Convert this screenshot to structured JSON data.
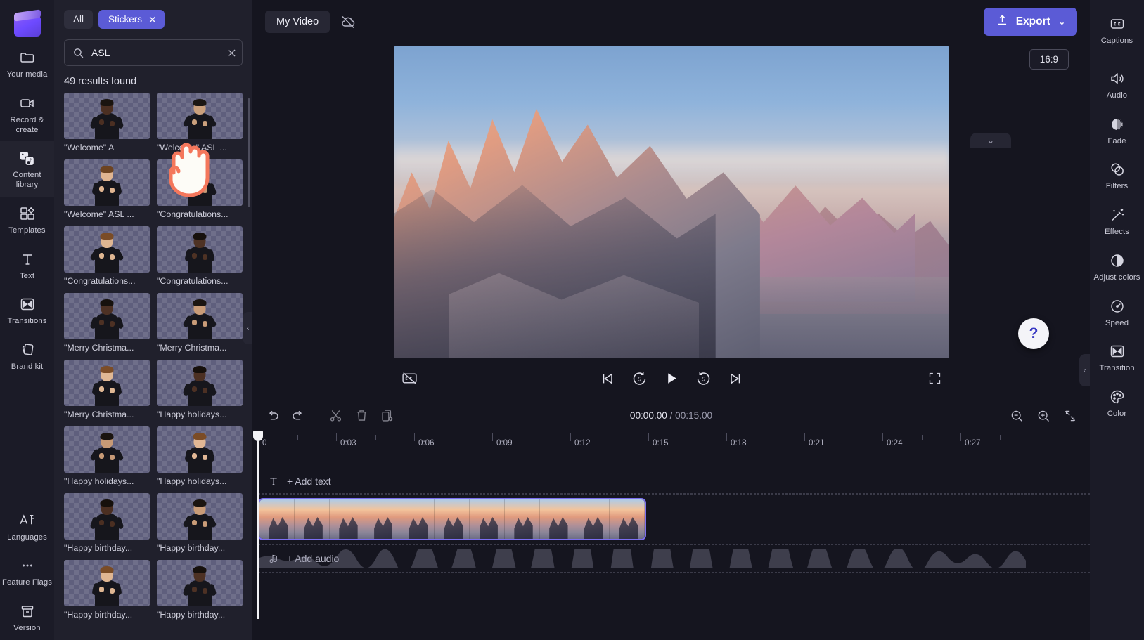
{
  "rail": {
    "logo": "clipchamp-logo",
    "items": [
      {
        "label": "Your media",
        "icon": "folder-icon",
        "active": false
      },
      {
        "label": "Record & create",
        "icon": "video-camera-icon",
        "active": false
      },
      {
        "label": "Content library",
        "icon": "content-library-icon",
        "active": true
      },
      {
        "label": "Templates",
        "icon": "templates-icon",
        "active": false
      },
      {
        "label": "Text",
        "icon": "text-icon",
        "active": false
      },
      {
        "label": "Transitions",
        "icon": "transitions-icon",
        "active": false
      },
      {
        "label": "Brand kit",
        "icon": "brand-kit-icon",
        "active": false
      }
    ],
    "bottom_items": [
      {
        "label": "Languages",
        "icon": "languages-icon"
      },
      {
        "label": "Feature Flags",
        "icon": "ellipsis-icon"
      },
      {
        "label": "Version",
        "icon": "archive-icon"
      }
    ]
  },
  "panel": {
    "chips": [
      {
        "label": "All",
        "selected": false
      },
      {
        "label": "Stickers",
        "selected": true,
        "close": "✕"
      }
    ],
    "search": {
      "value": "ASL",
      "placeholder": "Search",
      "clear": "✕"
    },
    "results_text": "49 results found",
    "collapse_arrow": "‹",
    "stickers": [
      {
        "label": "\"Welcome\" A",
        "skin": "#4b2f22",
        "hair": "#1a1410"
      },
      {
        "label": "\"Welcome\" ASL ...",
        "skin": "#caa07c",
        "hair": "#1c1713"
      },
      {
        "label": "\"Welcome\" ASL ...",
        "skin": "#e0b591",
        "hair": "#6d4422"
      },
      {
        "label": "\"Congratulations...",
        "skin": "#c59a76",
        "hair": "#191310"
      },
      {
        "label": "\"Congratulations...",
        "skin": "#dfb692",
        "hair": "#7a4c26"
      },
      {
        "label": "\"Congratulations...",
        "skin": "#4e3224",
        "hair": "#17110d"
      },
      {
        "label": "\"Merry Christma...",
        "skin": "#4d3124",
        "hair": "#17110d"
      },
      {
        "label": "\"Merry Christma...",
        "skin": "#c99c78",
        "hair": "#1b1511"
      },
      {
        "label": "\"Merry Christma...",
        "skin": "#e0b894",
        "hair": "#7c4d27"
      },
      {
        "label": "\"Happy holidays...",
        "skin": "#4c3023",
        "hair": "#16100c"
      },
      {
        "label": "\"Happy holidays...",
        "skin": "#c79a76",
        "hair": "#1a1410"
      },
      {
        "label": "\"Happy holidays...",
        "skin": "#e1b795",
        "hair": "#7b4c26"
      },
      {
        "label": "\"Happy birthday...",
        "skin": "#4b2f22",
        "hair": "#16100c"
      },
      {
        "label": "\"Happy birthday...",
        "skin": "#c99c78",
        "hair": "#1b1511"
      },
      {
        "label": "\"Happy birthday...",
        "skin": "#dfb692",
        "hair": "#7a4c26"
      },
      {
        "label": "\"Happy birthday...",
        "skin": "#4d3124",
        "hair": "#17110d"
      }
    ]
  },
  "topbar": {
    "project_name": "My Video",
    "cloud_status_icon": "cloud-off-icon",
    "export_label": "Export",
    "export_icon": "upload-icon",
    "export_chevron": "⌄"
  },
  "stage": {
    "aspect_ratio": "16:9",
    "help_label": "?",
    "collapse_arrow": "‹",
    "timeline_collapse_arrow": "⌄",
    "playback": {
      "captions_toggle": "captions-off-icon",
      "skip_start": "skip-to-start-icon",
      "rewind": "rewind-5-icon",
      "rewind_seconds": "5",
      "play": "play-icon",
      "forward": "forward-5-icon",
      "forward_seconds": "5",
      "skip_end": "skip-to-end-icon",
      "fullscreen": "fullscreen-icon"
    }
  },
  "timeline": {
    "tools": [
      {
        "name": "undo",
        "icon": "undo-icon"
      },
      {
        "name": "redo",
        "icon": "redo-icon"
      },
      {
        "name": "split",
        "icon": "scissors-icon"
      },
      {
        "name": "delete",
        "icon": "trash-icon"
      },
      {
        "name": "duplicate",
        "icon": "duplicate-icon"
      }
    ],
    "current_time": "00:00.00",
    "separator": " / ",
    "total_time": "00:15.00",
    "zoom_out_icon": "zoom-out-icon",
    "zoom_in_icon": "zoom-in-icon",
    "fit_icon": "fit-to-screen-icon",
    "ruler_labels": [
      "0",
      "0:03",
      "0:06",
      "0:09",
      "0:12",
      "0:15",
      "0:18",
      "0:21",
      "0:24",
      "0:27"
    ],
    "playhead_position": "0",
    "text_track": {
      "label": "+ Add text",
      "icon": "text-track-icon"
    },
    "audio_track": {
      "label": "+ Add audio",
      "icon": "music-note-icon"
    },
    "video_clip": {
      "name": "video-clip",
      "frames": 11,
      "selected": true
    }
  },
  "rightbar": {
    "items": [
      {
        "label": "Captions",
        "icon": "closed-captions-icon",
        "divider_after": true
      },
      {
        "label": "Audio",
        "icon": "speaker-icon",
        "divider_after": false
      },
      {
        "label": "Fade",
        "icon": "fade-icon",
        "divider_after": false
      },
      {
        "label": "Filters",
        "icon": "filters-icon",
        "divider_after": false
      },
      {
        "label": "Effects",
        "icon": "magic-wand-icon",
        "divider_after": false
      },
      {
        "label": "Adjust colors",
        "icon": "contrast-icon",
        "divider_after": false
      },
      {
        "label": "Speed",
        "icon": "speedometer-icon",
        "divider_after": false
      },
      {
        "label": "Transition",
        "icon": "transition-icon",
        "divider_after": false
      },
      {
        "label": "Color",
        "icon": "palette-icon",
        "divider_after": false
      }
    ]
  },
  "colors": {
    "accent": "#5b5bd6",
    "selection_border": "#7b6ef0",
    "background": "#15151f",
    "panel": "#20202c",
    "rail": "#1b1b27"
  }
}
